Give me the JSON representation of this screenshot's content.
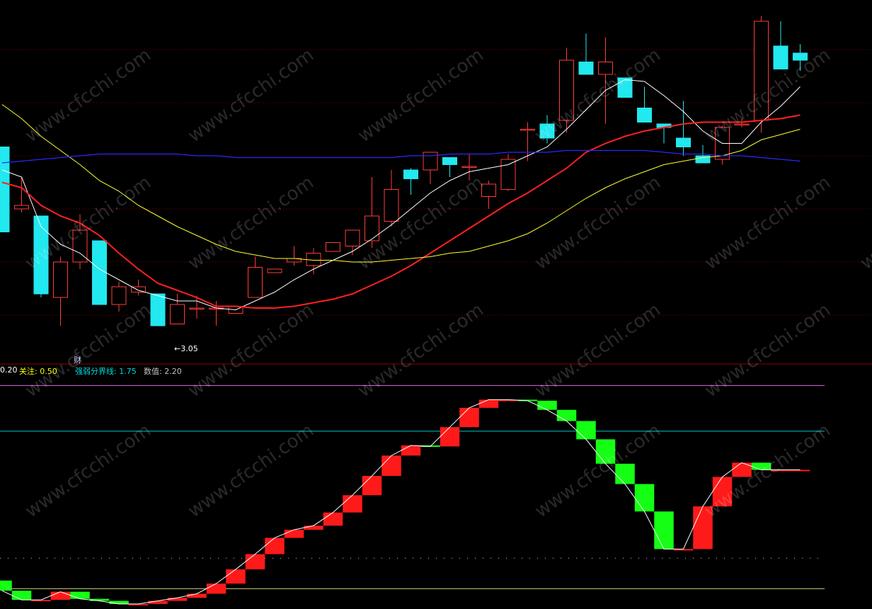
{
  "watermark": "www.cfcchi.com",
  "annotations": {
    "cai_tag": "财",
    "low_label": "←3.05"
  },
  "info_bar": [
    {
      "text": "0.20",
      "color": "#ffffff"
    },
    {
      "text": "关注: 0.50",
      "color": "#ffff00"
    },
    {
      "text": "强弱分界线: 1.75",
      "color": "#00d8d8"
    },
    {
      "text": "数值: 2.20",
      "color": "#c0c0c0"
    }
  ],
  "colors": {
    "bg": "#000000",
    "up": "#ff3b3b",
    "down": "#22e8ef",
    "ma5": "#ffffff",
    "ma10": "#ff2020",
    "ma20": "#ffff30",
    "ma60": "#2828ff",
    "osc_up": "#ff1a1a",
    "osc_down": "#14ff14",
    "grid": "#800000"
  },
  "chart_data": [
    {
      "type": "candlestick",
      "title": "",
      "x": [
        1,
        2,
        3,
        4,
        5,
        6,
        7,
        8,
        9,
        10,
        11,
        12,
        13,
        14,
        15,
        16,
        17,
        18,
        19,
        20,
        21,
        22,
        23,
        24,
        25,
        26,
        27,
        28,
        29,
        30,
        31,
        32,
        33,
        34,
        35,
        36,
        37,
        38,
        39,
        40,
        41,
        42
      ],
      "ohlc": [
        [
          4.05,
          4.05,
          3.57,
          3.57
        ],
        [
          3.7,
          3.88,
          3.68,
          3.72
        ],
        [
          3.66,
          3.66,
          3.2,
          3.22
        ],
        [
          3.2,
          3.43,
          3.04,
          3.4
        ],
        [
          3.4,
          3.67,
          3.36,
          3.58
        ],
        [
          3.52,
          3.52,
          3.16,
          3.16
        ],
        [
          3.16,
          3.29,
          3.12,
          3.26
        ],
        [
          3.23,
          3.3,
          3.21,
          3.26
        ],
        [
          3.22,
          3.22,
          3.04,
          3.04
        ],
        [
          3.05,
          3.22,
          3.05,
          3.16
        ],
        [
          3.14,
          3.21,
          3.08,
          3.14
        ],
        [
          3.14,
          3.18,
          3.04,
          3.14
        ],
        [
          3.11,
          3.15,
          3.11,
          3.15
        ],
        [
          3.2,
          3.43,
          3.2,
          3.37
        ],
        [
          3.34,
          3.36,
          3.34,
          3.36
        ],
        [
          3.4,
          3.49,
          3.38,
          3.42
        ],
        [
          3.38,
          3.48,
          3.33,
          3.45
        ],
        [
          3.46,
          3.51,
          3.46,
          3.51
        ],
        [
          3.49,
          3.58,
          3.44,
          3.58
        ],
        [
          3.52,
          3.88,
          3.48,
          3.66
        ],
        [
          3.63,
          3.92,
          3.6,
          3.81
        ],
        [
          3.92,
          3.93,
          3.78,
          3.87
        ],
        [
          3.92,
          4.02,
          3.84,
          4.02
        ],
        [
          3.99,
          3.99,
          3.88,
          3.95
        ],
        [
          3.94,
          4.01,
          3.86,
          3.94
        ],
        [
          3.77,
          3.86,
          3.7,
          3.84
        ],
        [
          3.81,
          4.01,
          3.8,
          3.98
        ],
        [
          4.15,
          4.19,
          3.97,
          4.15
        ],
        [
          4.18,
          4.23,
          4.07,
          4.1
        ],
        [
          4.2,
          4.61,
          4.13,
          4.54
        ],
        [
          4.53,
          4.69,
          4.52,
          4.46
        ],
        [
          4.46,
          4.67,
          4.18,
          4.53
        ],
        [
          4.44,
          4.44,
          4.33,
          4.33
        ],
        [
          4.27,
          4.39,
          4.19,
          4.19
        ],
        [
          4.18,
          4.18,
          4.07,
          4.16
        ],
        [
          4.1,
          4.31,
          4.0,
          4.05
        ],
        [
          4.0,
          4.06,
          3.96,
          3.96
        ],
        [
          3.98,
          4.17,
          3.95,
          4.16
        ],
        [
          4.18,
          4.21,
          4.16,
          4.18
        ],
        [
          4.2,
          4.79,
          4.13,
          4.76
        ],
        [
          4.62,
          4.76,
          4.49,
          4.49
        ],
        [
          4.58,
          4.63,
          4.48,
          4.54
        ]
      ],
      "moving_averages": [
        {
          "name": "MA5",
          "values": [
            3.92,
            3.88,
            3.6,
            3.5,
            3.45,
            3.36,
            3.3,
            3.24,
            3.21,
            3.18,
            3.18,
            3.14,
            3.13,
            3.18,
            3.23,
            3.3,
            3.36,
            3.41,
            3.46,
            3.53,
            3.61,
            3.7,
            3.79,
            3.86,
            3.91,
            3.93,
            3.95,
            4.0,
            4.05,
            4.15,
            4.26,
            4.37,
            4.43,
            4.42,
            4.34,
            4.25,
            4.14,
            4.07,
            4.07,
            4.19,
            4.28,
            4.39
          ]
        },
        {
          "name": "MA10",
          "values": [
            3.85,
            3.82,
            3.72,
            3.66,
            3.62,
            3.55,
            3.45,
            3.36,
            3.28,
            3.24,
            3.2,
            3.15,
            3.15,
            3.14,
            3.14,
            3.15,
            3.17,
            3.19,
            3.22,
            3.27,
            3.32,
            3.38,
            3.45,
            3.52,
            3.59,
            3.66,
            3.73,
            3.79,
            3.86,
            3.93,
            4.02,
            4.07,
            4.11,
            4.14,
            4.16,
            4.18,
            4.19,
            4.19,
            4.19,
            4.2,
            4.21,
            4.23
          ]
        },
        {
          "name": "MA20",
          "values": [
            4.29,
            4.21,
            4.11,
            4.03,
            3.95,
            3.86,
            3.8,
            3.72,
            3.66,
            3.6,
            3.55,
            3.5,
            3.46,
            3.44,
            3.42,
            3.42,
            3.41,
            3.41,
            3.4,
            3.4,
            3.41,
            3.42,
            3.43,
            3.45,
            3.46,
            3.49,
            3.52,
            3.56,
            3.62,
            3.69,
            3.76,
            3.82,
            3.87,
            3.91,
            3.95,
            3.97,
            3.99,
            4.0,
            4.03,
            4.09,
            4.12,
            4.15
          ]
        },
        {
          "name": "MA60",
          "values": [
            3.96,
            3.97,
            3.98,
            3.99,
            4.0,
            4.01,
            4.01,
            4.01,
            4.01,
            4.01,
            4.0,
            4.0,
            3.99,
            3.99,
            3.99,
            3.99,
            3.99,
            3.99,
            3.99,
            3.99,
            3.99,
            4.0,
            4.0,
            4.01,
            4.01,
            4.01,
            4.02,
            4.02,
            4.02,
            4.03,
            4.03,
            4.03,
            4.03,
            4.03,
            4.02,
            4.01,
            4.01,
            4.0,
            4.0,
            3.99,
            3.98,
            3.97
          ]
        }
      ],
      "ylim": [
        2.88,
        4.88
      ],
      "grid": true
    },
    {
      "type": "bar",
      "title": "",
      "x": [
        1,
        2,
        3,
        4,
        5,
        6,
        7,
        8,
        9,
        10,
        11,
        12,
        13,
        14,
        15,
        16,
        17,
        18,
        19,
        20,
        21,
        22,
        23,
        24,
        25,
        26,
        27,
        28,
        29,
        30,
        31,
        32,
        33,
        34,
        35,
        36,
        37,
        38,
        39,
        40,
        41,
        42
      ],
      "from": [
        0.28,
        0.18,
        0.09,
        0.09,
        0.17,
        0.1,
        0.08,
        0.05,
        0.05,
        0.08,
        0.11,
        0.15,
        0.25,
        0.39,
        0.54,
        0.7,
        0.78,
        0.82,
        0.95,
        1.12,
        1.31,
        1.51,
        1.61,
        1.6,
        1.79,
        1.98,
        2.06,
        2.06,
        2.05,
        1.96,
        1.85,
        1.67,
        1.43,
        1.23,
        0.96,
        0.59,
        0.59,
        1.01,
        1.3,
        1.44,
        1.37,
        1.37
      ],
      "to": [
        0.18,
        0.09,
        0.09,
        0.17,
        0.1,
        0.08,
        0.05,
        0.05,
        0.08,
        0.11,
        0.15,
        0.25,
        0.39,
        0.54,
        0.7,
        0.78,
        0.82,
        0.95,
        1.12,
        1.31,
        1.51,
        1.61,
        1.6,
        1.79,
        1.98,
        2.06,
        2.06,
        2.05,
        1.96,
        1.85,
        1.67,
        1.43,
        1.23,
        0.96,
        0.59,
        0.59,
        1.01,
        1.3,
        1.44,
        1.37,
        1.37,
        1.37
      ],
      "guides": [
        0.2,
        0.5,
        1.75,
        2.2
      ],
      "ylim": [
        0.0,
        2.3
      ]
    }
  ]
}
